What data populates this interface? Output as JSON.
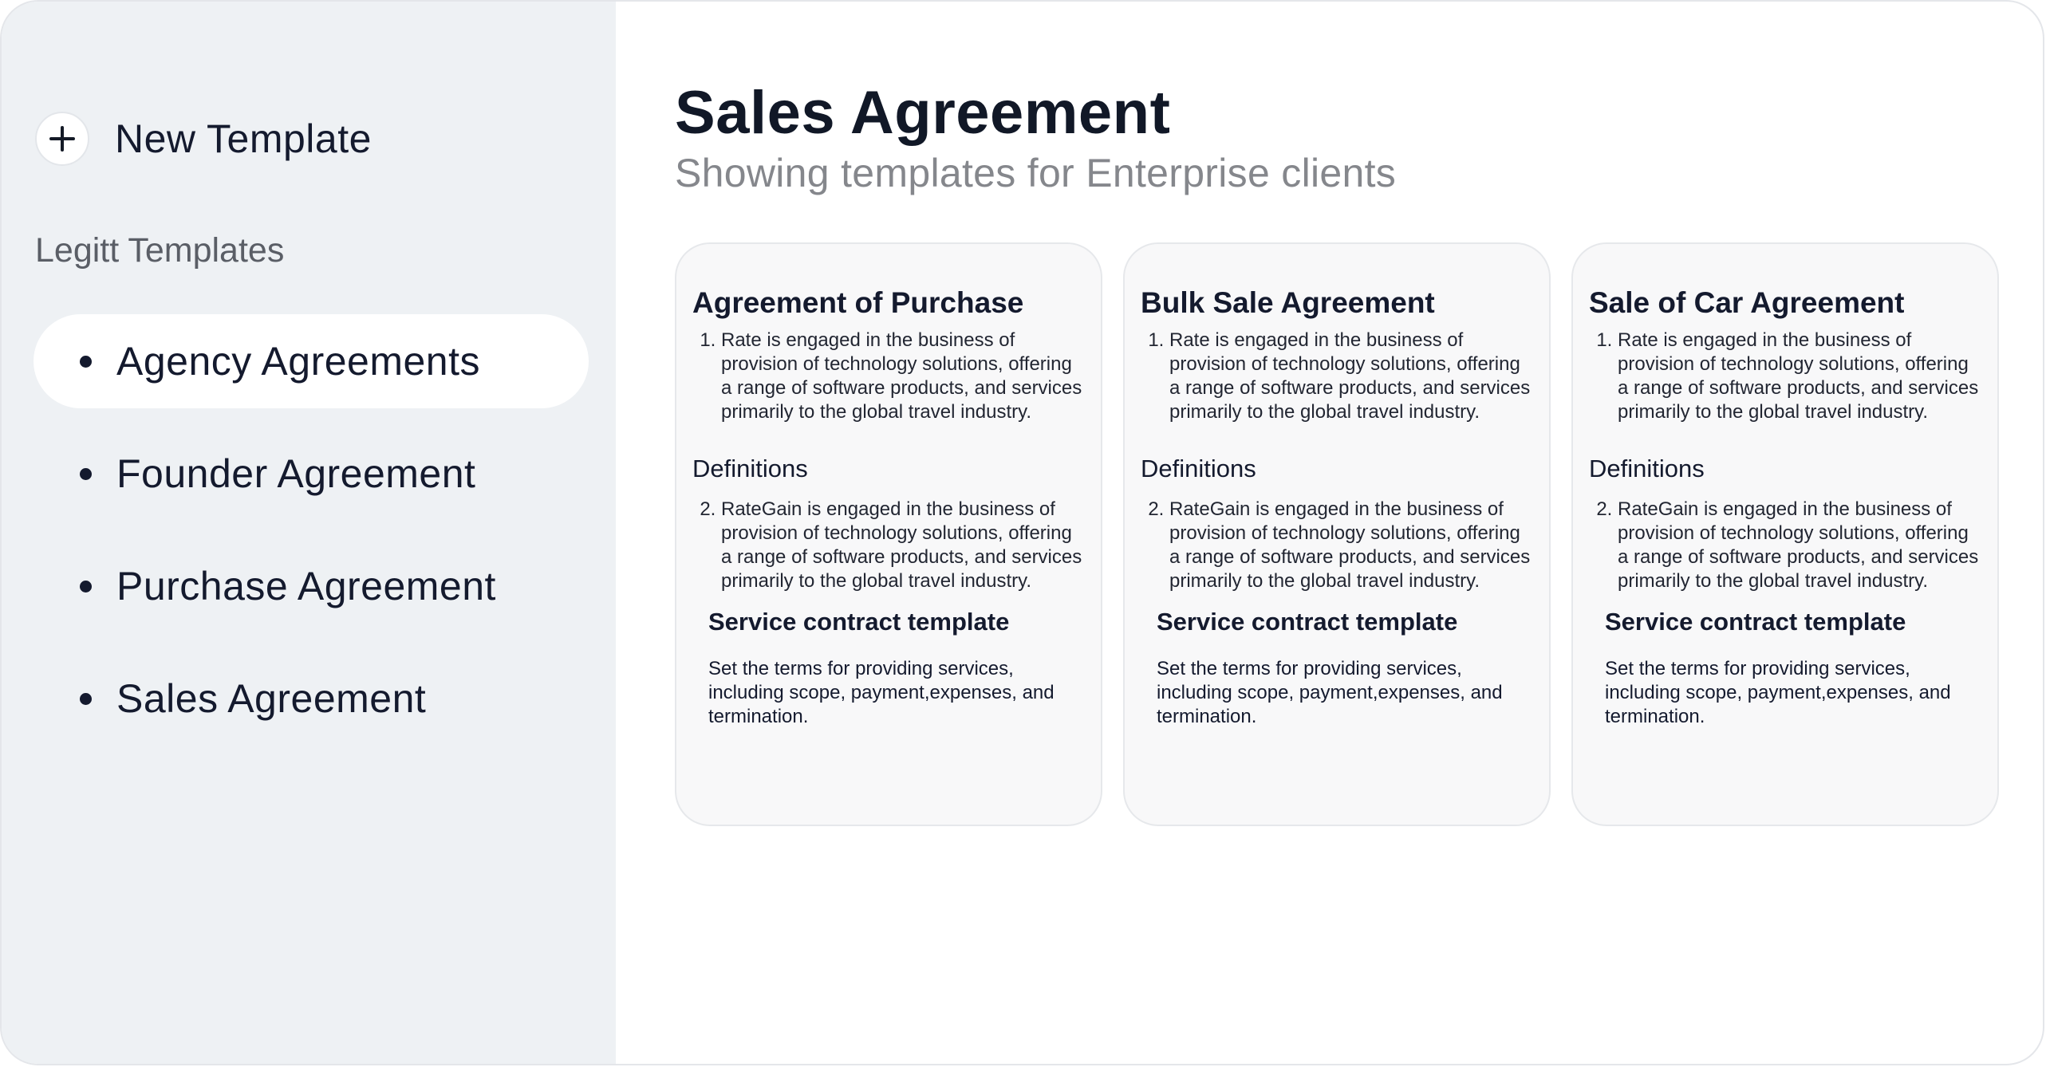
{
  "sidebar": {
    "new_template_label": "New Template",
    "section_label": "Legitt Templates",
    "items": [
      {
        "label": "Agency Agreements",
        "active": true
      },
      {
        "label": "Founder Agreement",
        "active": false
      },
      {
        "label": "Purchase Agreement",
        "active": false
      },
      {
        "label": "Sales Agreement",
        "active": false
      }
    ]
  },
  "main": {
    "title": "Sales Agreement",
    "subtitle": "Showing templates for Enterprise clients",
    "cards": [
      {
        "title": "Agreement of Purchase",
        "clause_1": "Rate is engaged in the business of provision of technology solutions, offering a range of software products, and services primarily to the global travel industry.",
        "definitions_label": "Definitions",
        "clause_2": "RateGain is engaged in the business of provision of technology solutions, offering a range of software products, and services primarily to the global travel industry.",
        "service_title": "Service contract template",
        "service_desc": "Set the terms for providing services, including scope, payment,expenses, and termination."
      },
      {
        "title": "Bulk Sale Agreement",
        "clause_1": "Rate is engaged in the business of provision of technology solutions, offering a range of software products, and services primarily to the global travel industry.",
        "definitions_label": "Definitions",
        "clause_2": "RateGain is engaged in the business of provision of technology solutions, offering a range of software products, and services primarily to the global travel industry.",
        "service_title": "Service contract template",
        "service_desc": "Set the terms for providing services, including scope, payment,expenses, and termination."
      },
      {
        "title": "Sale of Car Agreement",
        "clause_1": "Rate is engaged in the business of provision of technology solutions, offering a range of software products, and services primarily to the global travel industry.",
        "definitions_label": "Definitions",
        "clause_2": "RateGain is engaged in the business of provision of technology solutions, offering a range of software products, and services primarily to the global travel industry.",
        "service_title": "Service contract template",
        "service_desc": "Set the terms for providing services, including scope, payment,expenses, and termination."
      }
    ]
  },
  "icons": {
    "new_template": "plus-icon",
    "nav_bullet": "bullet-icon"
  },
  "colors": {
    "sidebar_bg": "#eef1f4",
    "text_primary": "#141a2e",
    "text_muted": "#85878c",
    "card_bg": "#f8f8f9"
  }
}
